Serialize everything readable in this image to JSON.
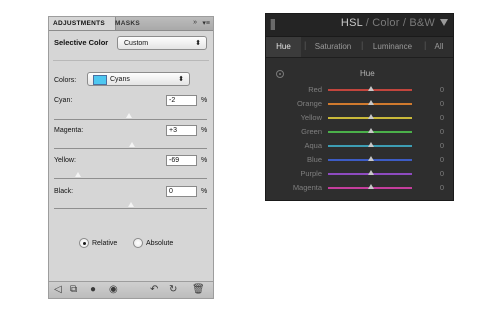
{
  "photoshop": {
    "tabs": {
      "adjustments": "ADJUSTMENTS",
      "masks": "MASKS"
    },
    "tab_controls": {
      "expand": "»",
      "menu": "▾≡"
    },
    "title": "Selective Color",
    "preset": "Custom",
    "colors_label": "Colors:",
    "colors_value": "Cyans",
    "swatch_color": "#4dc7f0",
    "sliders": [
      {
        "label": "Cyan:",
        "value": "-2",
        "unit": "%",
        "fraction": 0.49
      },
      {
        "label": "Magenta:",
        "value": "+3",
        "unit": "%",
        "fraction": 0.51
      },
      {
        "label": "Yellow:",
        "value": "-69",
        "unit": "%",
        "fraction": 0.16
      },
      {
        "label": "Black:",
        "value": "0",
        "unit": "%",
        "fraction": 0.5
      }
    ],
    "method": {
      "relative": "Relative",
      "absolute": "Absolute",
      "selected": "relative"
    },
    "bottom_icons": [
      "back-icon",
      "clip-icon",
      "visibility-icon",
      "eye-icon",
      "previous-state-icon",
      "reset-icon",
      "trash-icon"
    ]
  },
  "lightroom": {
    "title_main": "HSL",
    "title_rest": " / Color / B&W",
    "tabs": [
      "Hue",
      "Saturation",
      "Luminance",
      "All"
    ],
    "active_tab": "Hue",
    "section": "Hue",
    "rows": [
      {
        "label": "Red",
        "value": "0",
        "gradient": "#c2453d"
      },
      {
        "label": "Orange",
        "value": "0",
        "gradient": "#d07a2e"
      },
      {
        "label": "Yellow",
        "value": "0",
        "gradient": "#c9b93a"
      },
      {
        "label": "Green",
        "value": "0",
        "gradient": "#4bb04a"
      },
      {
        "label": "Aqua",
        "value": "0",
        "gradient": "#3d9db3"
      },
      {
        "label": "Blue",
        "value": "0",
        "gradient": "#3d5cc4"
      },
      {
        "label": "Purple",
        "value": "0",
        "gradient": "#8e4bc0"
      },
      {
        "label": "Magenta",
        "value": "0",
        "gradient": "#c43e9c"
      }
    ]
  }
}
